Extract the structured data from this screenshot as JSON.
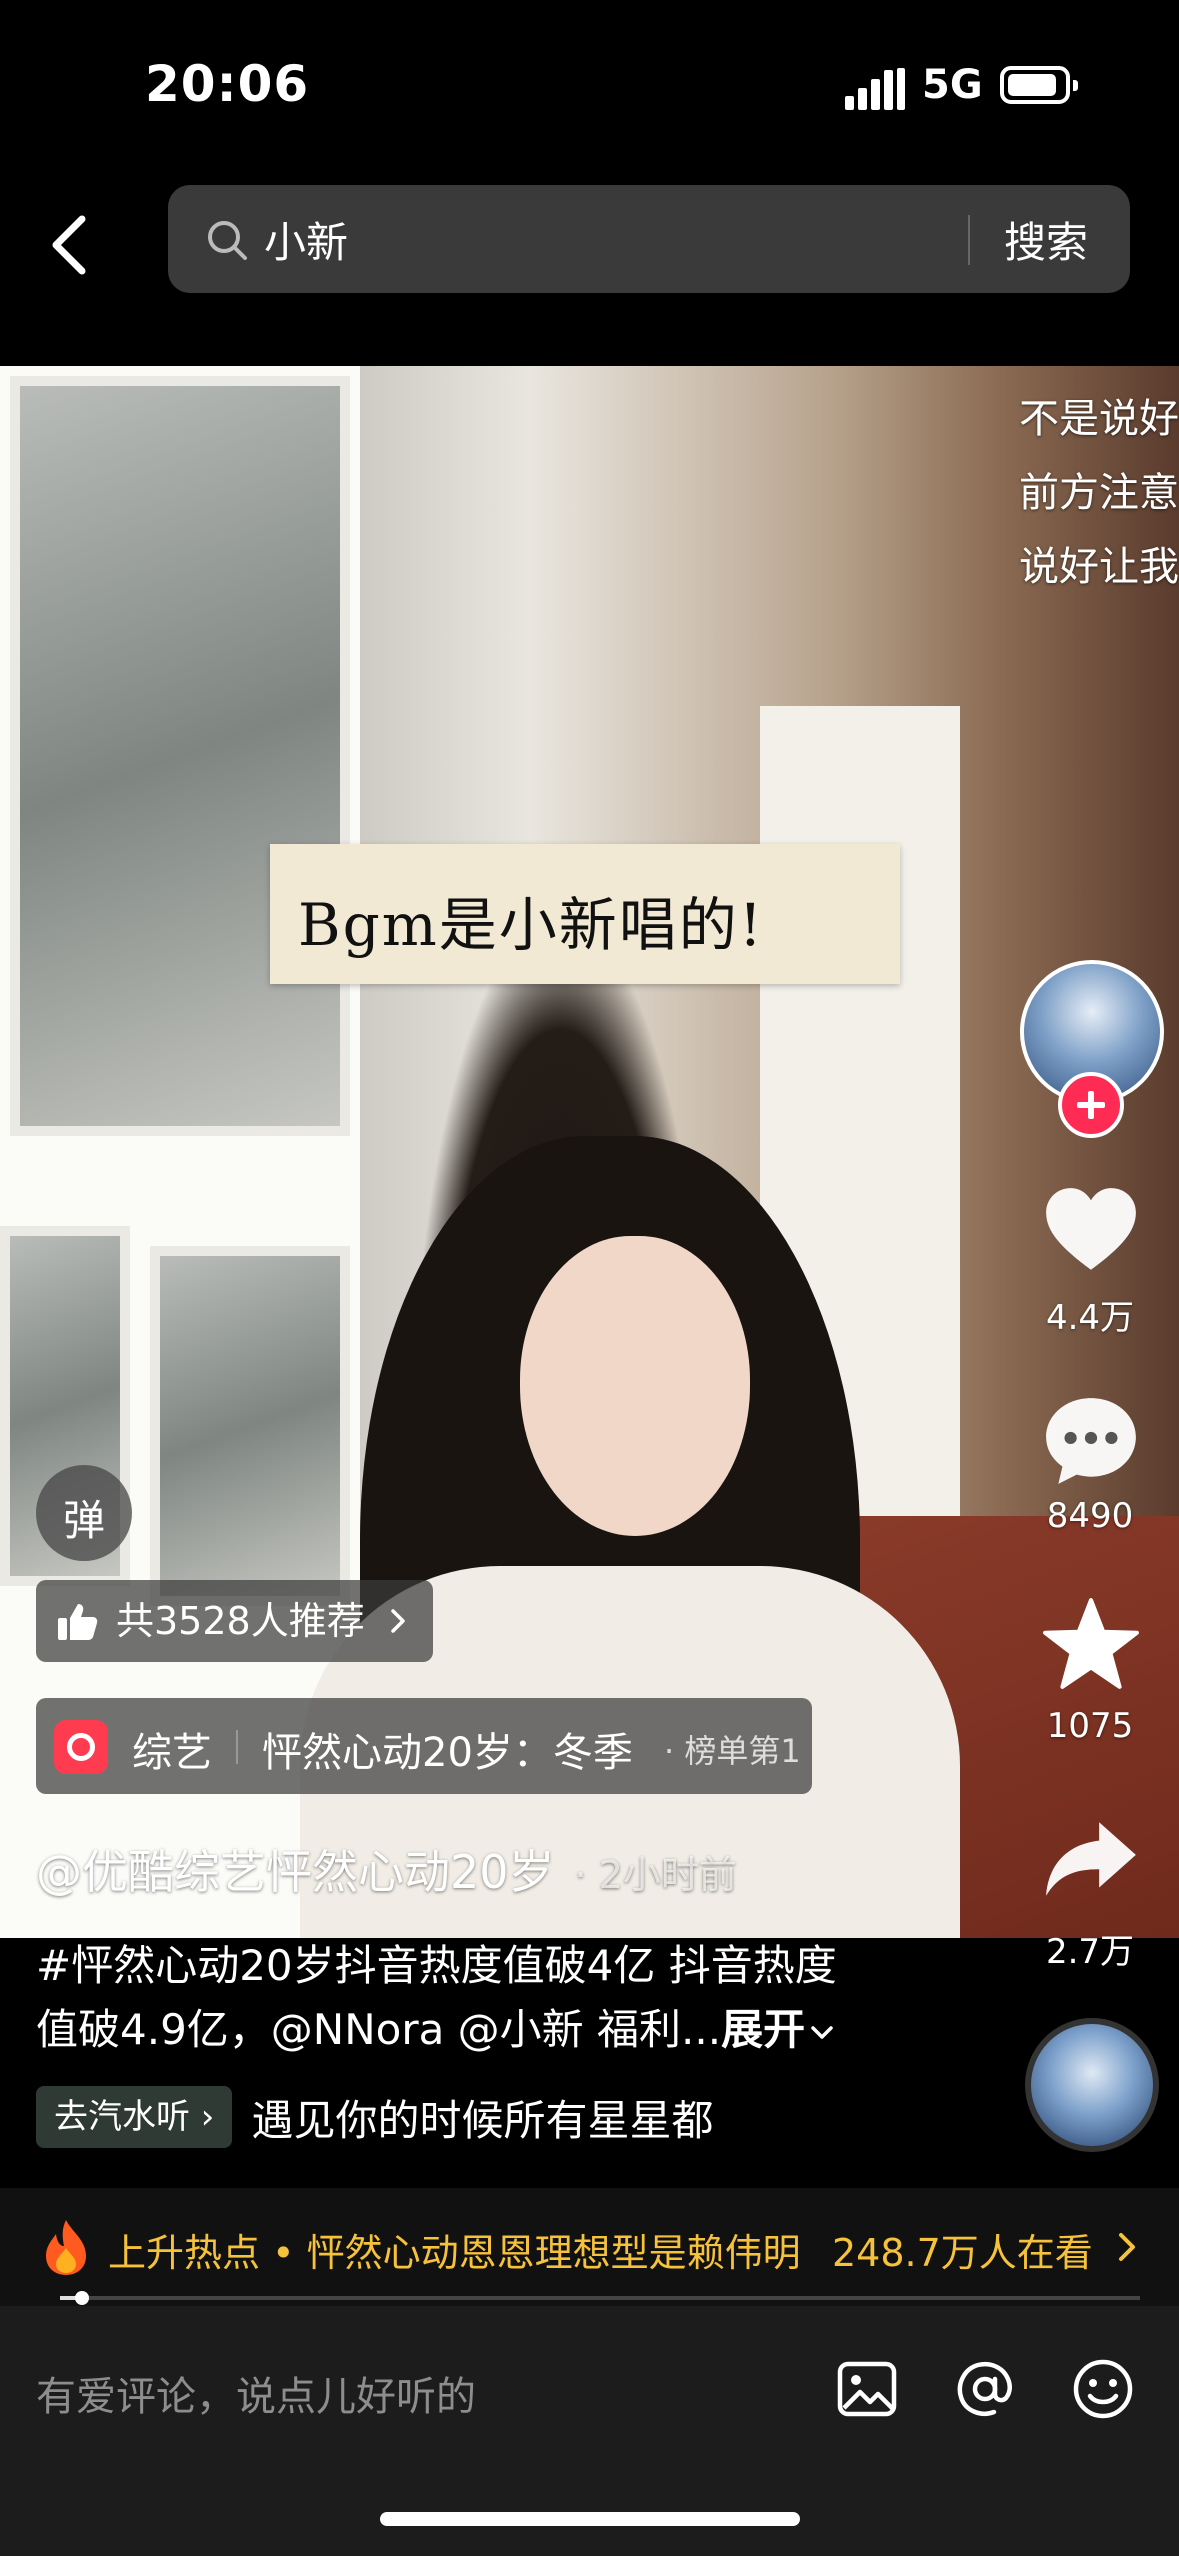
{
  "status_bar": {
    "time": "20:06",
    "network": "5G"
  },
  "search": {
    "query": "小新",
    "button_label": "搜索"
  },
  "video": {
    "sticker_text": "Bgm是小新唱的!",
    "danmaku": [
      "不是说好",
      "前方注意",
      "说好让我"
    ]
  },
  "rail": {
    "likes": "4.4万",
    "comments": "8490",
    "favorites": "1075",
    "shares": "2.7万"
  },
  "overlay": {
    "danmu_label": "弹",
    "recommend_label": "共3528人推荐",
    "variety_category": "综艺",
    "variety_title": "怦然心动20岁：冬季",
    "variety_rank": "· 榜单第1"
  },
  "post": {
    "author": "@优酷综艺怦然心动20岁",
    "time_ago": "· 2小时前",
    "desc_line1": "#怦然心动20岁抖音热度值破4亿 抖音热度",
    "desc_line2": "值破4.9亿，@NNora @小新 福利...",
    "expand_label": "展开",
    "music_tag": "去汽水听",
    "music_name": "遇见你的时候所有星星都"
  },
  "hot": {
    "text": "上升热点 • 怦然心动恩恩理想型是赖伟明",
    "viewers": "248.7万人在看"
  },
  "playback": {
    "progress": 0.02
  },
  "comment": {
    "placeholder": "有爱评论，说点儿好听的"
  },
  "colors": {
    "accent_red": "#fe2c55",
    "hot_yellow": "#f6c23b"
  }
}
